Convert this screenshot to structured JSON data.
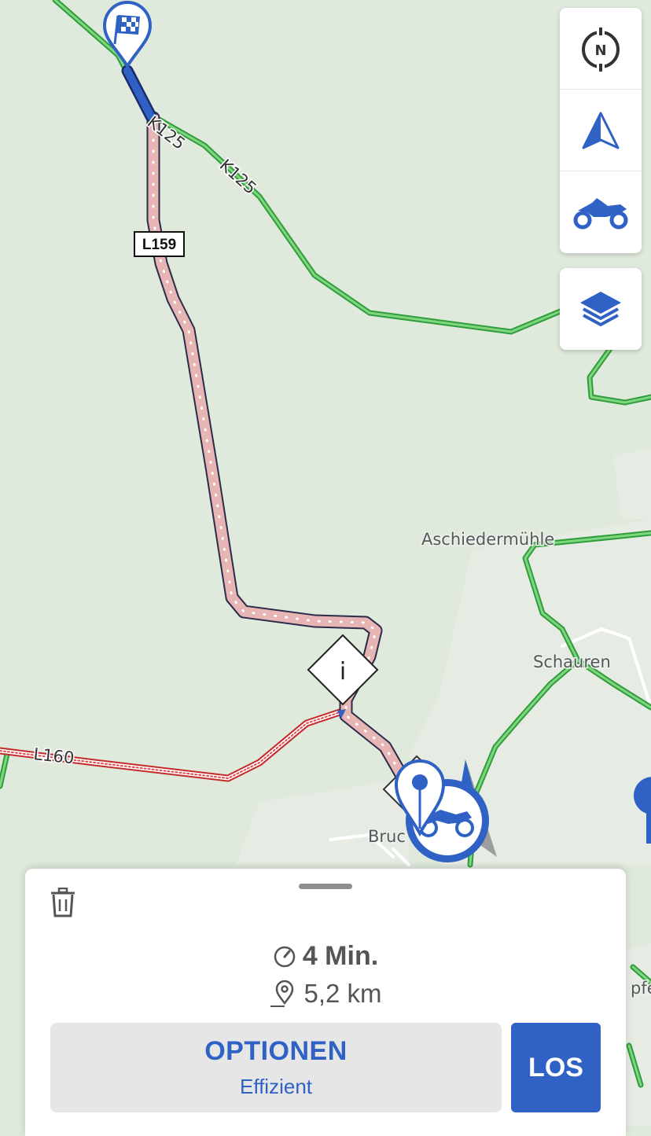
{
  "map": {
    "place_labels": {
      "aschiedermuehle": "Aschiedermühle",
      "schauren": "Schauren",
      "bruch": "Bruc",
      "partial_right": "pfe"
    },
    "road_labels": {
      "k125_a": "K125",
      "k125_b": "K125",
      "l160": "L160"
    },
    "road_shields": {
      "l159": "L159"
    },
    "info_marker": "i",
    "route_color": "#2f62c4"
  },
  "controls": {
    "compass_letter": "N",
    "icons": [
      "compass-north-icon",
      "navigation-arrow-icon",
      "motorcycle-icon",
      "layers-icon"
    ]
  },
  "route_sheet": {
    "duration": "4 Min.",
    "distance": "5,2 km",
    "options_label": "OPTIONEN",
    "options_mode": "Effizient",
    "go_label": "LOS"
  },
  "colors": {
    "accent": "#2f62c4",
    "map_background": "#dfe9dc",
    "green_road": "#4cbb55",
    "route_fill": "#e8b5b5"
  }
}
